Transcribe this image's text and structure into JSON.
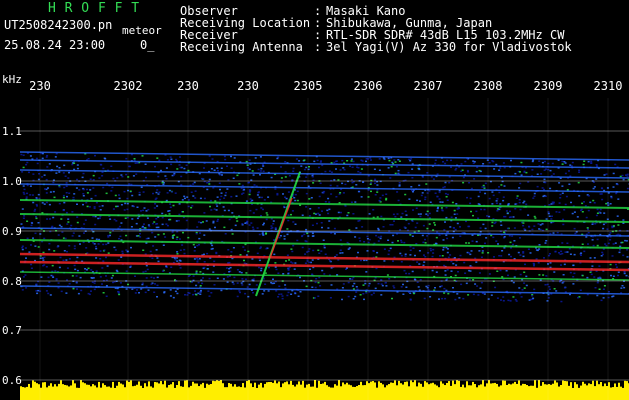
{
  "header": {
    "brand": "H R O F F T",
    "filename": "UT2508242300.pn",
    "meteor_label": "meteor",
    "datetime": "25.08.24 23:00",
    "count": "0_",
    "fields": [
      {
        "label": "Observer",
        "value": "Masaki Kano"
      },
      {
        "label": "Receiving Location",
        "value": "Shibukawa, Gunma, Japan"
      },
      {
        "label": "Receiver",
        "value": "RTL-SDR SDR# 43dB L15 103.2MHz CW"
      },
      {
        "label": "Receiving Antenna",
        "value": "3el Yagi(V) Az 330 for Vladivostok"
      }
    ]
  },
  "spectrogram": {
    "y_unit": "kHz",
    "y_ticks": [
      "1.1",
      "1.0",
      "0.9",
      "0.8",
      "0.7",
      "0.6"
    ],
    "x_ticks": [
      "230",
      "2302",
      "230",
      "230",
      "2305",
      "2306",
      "2307",
      "2308",
      "2309",
      "2310"
    ],
    "colors": {
      "background": "#000000",
      "noise_low": "#0a1aa0",
      "noise_mid": "#2a6cff",
      "signal": "#22dd44",
      "strong": "#ff2a2a",
      "amplitude": "#ffee00"
    }
  }
}
